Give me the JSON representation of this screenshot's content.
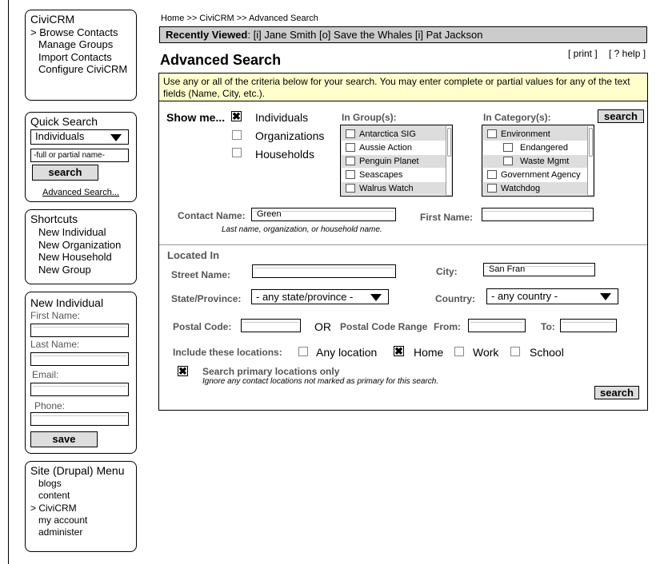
{
  "sidebar": {
    "civicrm": {
      "title": "CiviCRM",
      "items": [
        "> Browse Contacts",
        "Manage Groups",
        "Import Contacts",
        "Configure CiviCRM"
      ]
    },
    "quick_search": {
      "title": "Quick Search",
      "type_value": "Individuals",
      "name_placeholder": "-full or partial name-",
      "search_label": "search",
      "advanced_link": "Advanced Search..."
    },
    "shortcuts": {
      "title": "Shortcuts",
      "items": [
        "New Individual",
        "New Organization",
        "New Household",
        "New Group"
      ]
    },
    "new_individual": {
      "title": "New Individual",
      "first_name": "First Name:",
      "last_name": "Last Name:",
      "email": "Email:",
      "phone": "Phone:",
      "save_label": "save"
    },
    "site_menu": {
      "title": "Site (Drupal) Menu",
      "items": [
        "blogs",
        "content",
        "> CiviCRM",
        "my account",
        "administer"
      ]
    }
  },
  "header": {
    "breadcrumb": "Home >> CiviCRM >> Advanced Search",
    "recently_viewed_label": "Recently Viewed",
    "recently_viewed_items": ": [i] Jane Smith  [o] Save the Whales  [i] Pat Jackson",
    "page_title": "Advanced Search",
    "print_link": "[ print ]",
    "help_link": "[ ? help ]"
  },
  "main": {
    "instructions": "Use any or all of the criteria below for your search. You may enter complete or partial values for any of the text fields (Name, City, etc.).",
    "show_me": {
      "label": "Show me...",
      "options": [
        {
          "label": "Individuals",
          "checked": true
        },
        {
          "label": "Organizations",
          "checked": false
        },
        {
          "label": "Households",
          "checked": false
        }
      ]
    },
    "groups": {
      "label": "In Group(s):",
      "items": [
        "Antarctica SIG",
        "Aussie Action",
        "Penguin Planet",
        "Seascapes",
        "Walrus Watch"
      ]
    },
    "categories": {
      "label": "In Category(s):",
      "items": [
        "Environment",
        "Endangered",
        "Waste Mgmt",
        "Government Agency",
        "Watchdog"
      ]
    },
    "search_label": "search",
    "contact_name_label": "Contact Name:",
    "contact_name_value": "Green",
    "contact_name_hint": "Last name, organization, or household name.",
    "first_name_label": "First Name:",
    "located_in": "Located In",
    "street_name_label": "Street Name:",
    "city_label": "City:",
    "city_value": "San Fran",
    "state_label": "State/Province:",
    "state_value": "- any state/province -",
    "country_label": "Country:",
    "country_value": "- any country -",
    "postal_code_label": "Postal Code:",
    "or_label": "OR",
    "postal_range_label": "Postal Code Range",
    "from_label": "From:",
    "to_label": "To:",
    "include_label": "Include these locations:",
    "locations": [
      {
        "label": "Any location",
        "checked": false
      },
      {
        "label": "Home",
        "checked": true
      },
      {
        "label": "Work",
        "checked": false
      },
      {
        "label": "School",
        "checked": false
      }
    ],
    "primary_label": "Search primary locations only",
    "primary_hint": "Ignore any contact locations not marked as primary for this search.",
    "primary_checked": true
  }
}
